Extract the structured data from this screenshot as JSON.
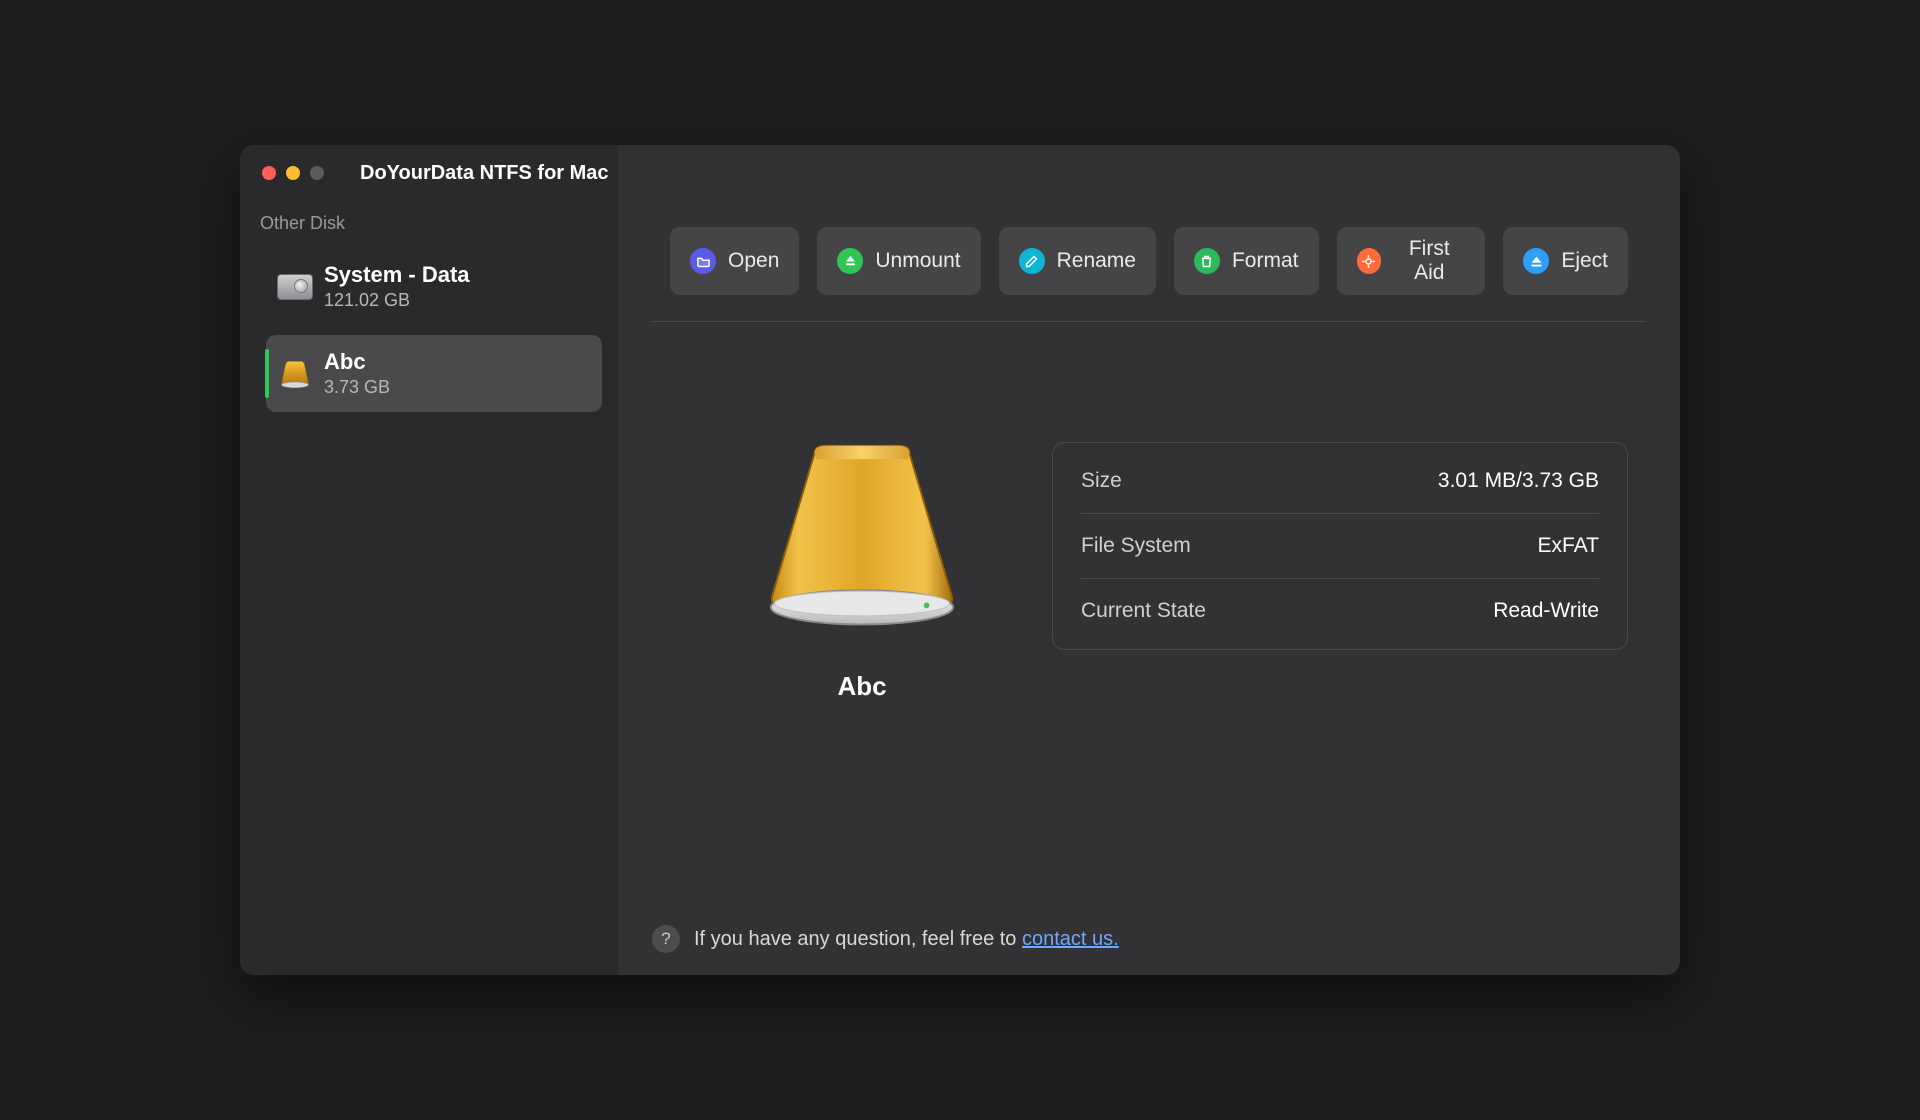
{
  "app": {
    "title": "DoYourData NTFS for Mac"
  },
  "sidebar": {
    "section_label": "Other Disk",
    "items": [
      {
        "name": "System - Data",
        "sub": "121.02 GB"
      },
      {
        "name": "Abc",
        "sub": "3.73 GB"
      }
    ]
  },
  "toolbar": {
    "open": "Open",
    "unmount": "Unmount",
    "rename": "Rename",
    "format": "Format",
    "firstaid": "First Aid",
    "eject": "Eject"
  },
  "detail": {
    "drive_label": "Abc",
    "rows": {
      "size_label": "Size",
      "size_value": "3.01 MB/3.73 GB",
      "fs_label": "File System",
      "fs_value": "ExFAT",
      "state_label": "Current State",
      "state_value": "Read-Write"
    }
  },
  "footer": {
    "text": "If you have any question, feel free to ",
    "link": "contact us."
  }
}
